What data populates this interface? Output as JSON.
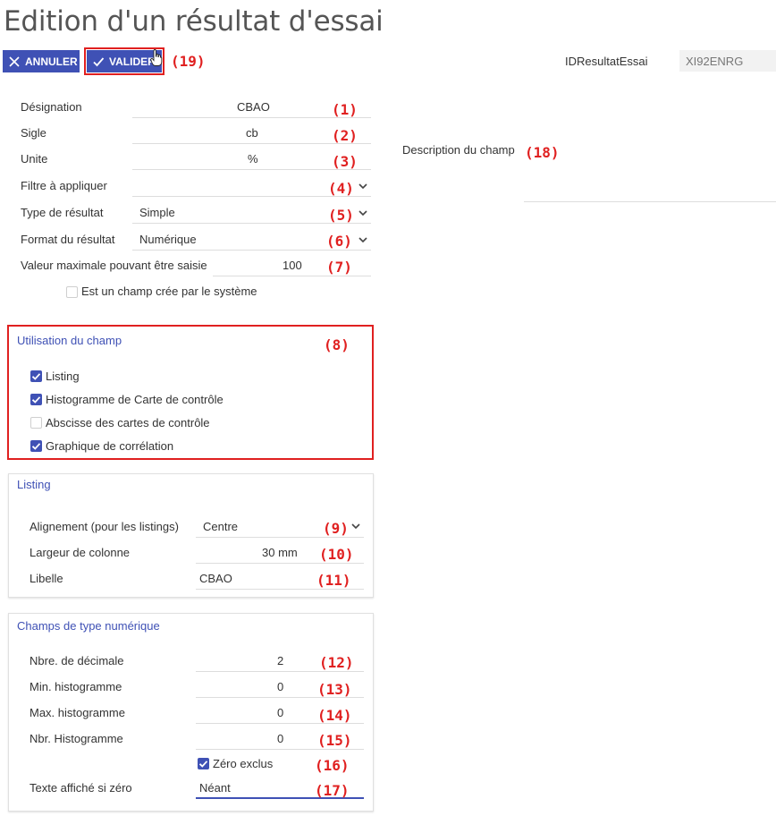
{
  "page": {
    "title": "Edition d'un résultat d'essai"
  },
  "toolbar": {
    "cancel_label": "ANNULER",
    "validate_label": "VALIDER"
  },
  "header": {
    "id_label": "IDResultatEssai",
    "id_value": "XI92ENRG"
  },
  "form": {
    "designation": {
      "label": "Désignation",
      "value": "CBAO"
    },
    "sigle": {
      "label": "Sigle",
      "value": "cb"
    },
    "unite": {
      "label": "Unite",
      "value": "%"
    },
    "filtre": {
      "label": "Filtre à appliquer",
      "value": ""
    },
    "type_resultat": {
      "label": "Type de résultat",
      "value": "Simple"
    },
    "format_resultat": {
      "label": "Format du résultat",
      "value": "Numérique"
    },
    "valeur_max": {
      "label": "Valeur maximale pouvant être saisie",
      "value": "100"
    },
    "champ_systeme": {
      "label": "Est un champ crée par le système",
      "checked": false
    }
  },
  "description": {
    "label": "Description du champ",
    "value": ""
  },
  "utilisation": {
    "title": "Utilisation du champ",
    "items": [
      {
        "label": "Listing",
        "checked": true
      },
      {
        "label": "Histogramme de Carte de contrôle",
        "checked": true
      },
      {
        "label": "Abscisse des cartes de contrôle",
        "checked": false
      },
      {
        "label": "Graphique de corrélation",
        "checked": true
      }
    ]
  },
  "listing": {
    "title": "Listing",
    "alignement": {
      "label": "Alignement (pour les listings)",
      "value": "Centre"
    },
    "largeur": {
      "label": "Largeur de colonne",
      "value": "30 mm"
    },
    "libelle": {
      "label": "Libelle",
      "value": "CBAO"
    }
  },
  "numerique": {
    "title": "Champs de type numérique",
    "decimales": {
      "label": "Nbre. de décimale",
      "value": "2"
    },
    "min_histo": {
      "label": "Min. histogramme",
      "value": "0"
    },
    "max_histo": {
      "label": "Max. histogramme",
      "value": "0"
    },
    "nbr_histo": {
      "label": "Nbr. Histogramme",
      "value": "0"
    },
    "zero_exclus": {
      "label": "Zéro exclus",
      "checked": true
    },
    "texte_zero": {
      "label": "Texte affiché si zéro",
      "value": "Néant"
    }
  },
  "annotations": [
    "(1)",
    "(2)",
    "(3)",
    "(4)",
    "(5)",
    "(6)",
    "(7)",
    "(8)",
    "(9)",
    "(10)",
    "(11)",
    "(12)",
    "(13)",
    "(14)",
    "(15)",
    "(16)",
    "(17)",
    "(18)",
    "(19)"
  ],
  "colors": {
    "accent": "#3f51b5",
    "annotation": "#e02020",
    "title": "#555555"
  }
}
